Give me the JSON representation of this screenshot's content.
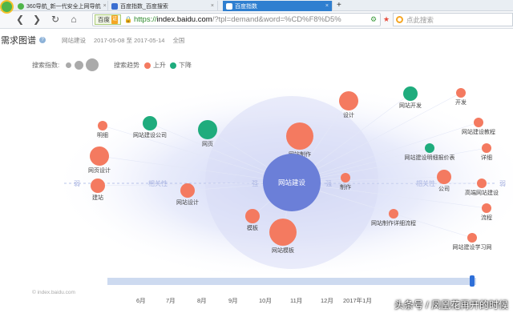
{
  "browser": {
    "tabs": [
      {
        "label": "360导航_新一代安全上网导航",
        "favicon_color": "#4fb54a",
        "active": false
      },
      {
        "label": "百度指数_百度搜索",
        "favicon_color": "#3b6fd1",
        "active": false
      },
      {
        "label": "百度指数",
        "favicon_color": "#3b6fd1",
        "active": true
      }
    ],
    "new_tab": "+",
    "nav": {
      "back": "❮",
      "forward": "❯",
      "reload": "↻",
      "home": "⌂"
    },
    "engine_label": "百度",
    "engine_badge": "证",
    "url_https": "https://",
    "url_host": "index.baidu.com",
    "url_rest": "/?tpl=demand&word=%CD%F8%D5%",
    "search_placeholder": "点此搜索"
  },
  "page": {
    "title": "需求图谱",
    "help": "?",
    "keyword": "网站建设",
    "date_start": "2017-05-08",
    "date_sep": "至",
    "date_end": "2017-05-14",
    "region": "全国"
  },
  "legend": {
    "search_index_label": "搜索指数:",
    "trend_label": "搜索趋势",
    "up_label": "上升",
    "down_label": "下降",
    "up_color": "#f47a60",
    "down_color": "#1fac7d",
    "index_color": "#aaaaaa"
  },
  "chart_data": {
    "type": "bubble-relation-graph",
    "center": {
      "label": "网站建设",
      "color": "#6b7fd8"
    },
    "axis_labels": {
      "weak": "弱",
      "strong": "强",
      "relevance": "相关性"
    },
    "nodes": [
      {
        "label": "明细",
        "trend": "up",
        "size": 1
      },
      {
        "label": "网站建设公司",
        "trend": "down",
        "size": 2
      },
      {
        "label": "网页",
        "trend": "down",
        "size": 3
      },
      {
        "label": "网页设计",
        "trend": "up",
        "size": 3
      },
      {
        "label": "建站",
        "trend": "up",
        "size": 2
      },
      {
        "label": "网站设计",
        "trend": "up",
        "size": 2
      },
      {
        "label": "网站制作",
        "trend": "up",
        "size": 4
      },
      {
        "label": "模板",
        "trend": "up",
        "size": 2
      },
      {
        "label": "网站模板",
        "trend": "up",
        "size": 4
      },
      {
        "label": "制作",
        "trend": "up",
        "size": 1
      },
      {
        "label": "设计",
        "trend": "up",
        "size": 3
      },
      {
        "label": "网站开发",
        "trend": "down",
        "size": 2
      },
      {
        "label": "开发",
        "trend": "up",
        "size": 1
      },
      {
        "label": "网站建设教程",
        "trend": "up",
        "size": 1
      },
      {
        "label": "网站建设明细报价表",
        "trend": "down",
        "size": 1
      },
      {
        "label": "详细",
        "trend": "up",
        "size": 1
      },
      {
        "label": "公司",
        "trend": "up",
        "size": 2
      },
      {
        "label": "高端网站建设",
        "trend": "up",
        "size": 1
      },
      {
        "label": "流程",
        "trend": "up",
        "size": 1
      },
      {
        "label": "网站制作详细流程",
        "trend": "up",
        "size": 1
      },
      {
        "label": "网站建设学习网",
        "trend": "up",
        "size": 1
      }
    ]
  },
  "timeline": {
    "months": [
      "6月",
      "7月",
      "8月",
      "9月",
      "10月",
      "11月",
      "12月",
      "2017年1月"
    ]
  },
  "source": "© index.baidu.com",
  "credit": "头条号 / 凤凰花再开的时候"
}
